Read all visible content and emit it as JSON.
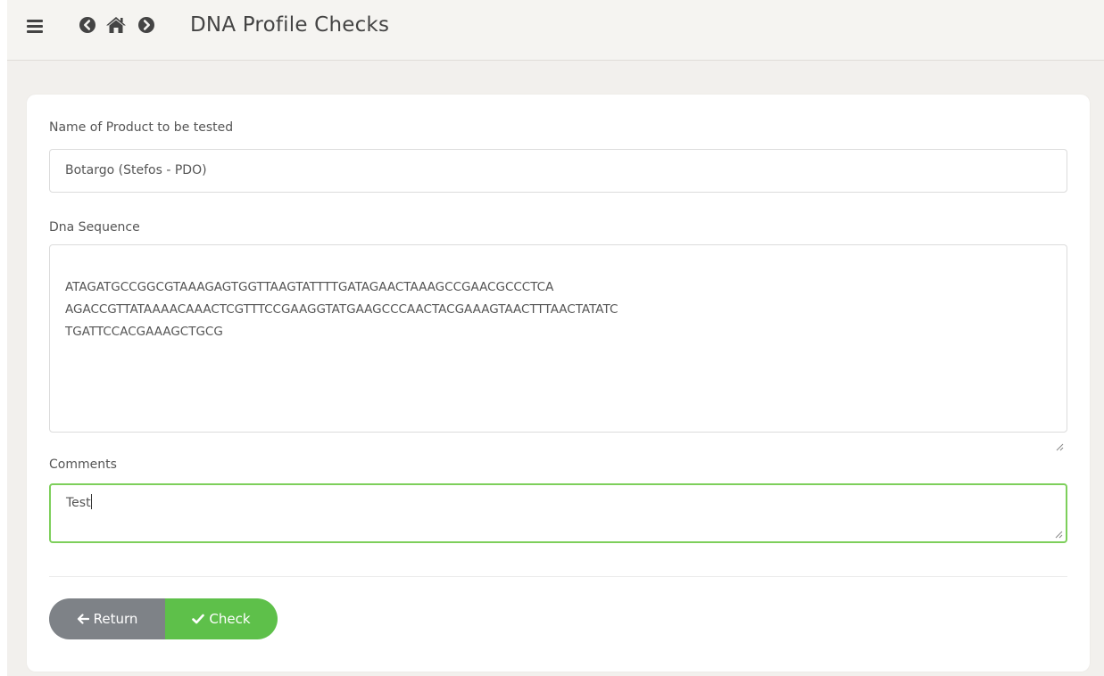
{
  "header": {
    "title": "DNA Profile Checks",
    "icons": [
      "menu-icon",
      "back-circle-icon",
      "home-icon",
      "forward-circle-icon"
    ]
  },
  "form": {
    "product": {
      "label": "Name of Product to be tested",
      "value": "Botargo (Stefos - PDO)"
    },
    "dna": {
      "label": "Dna Sequence",
      "value": "ATAGATGCCGGCGTAAAGAGTGGTTAAGTATTTTGATAGAACTAAAGCCGAACGCCCTCA\nAGACCGTTATAAAACAAACTCGTTTCCGAAGGTATGAAGCCCAACTACGAAAGTAACTTTAACTATATC\nTGATTCCACGAAAGCTGCG"
    },
    "comments": {
      "label": "Comments",
      "value": "Test"
    }
  },
  "actions": {
    "return_label": "Return",
    "check_label": "Check"
  },
  "colors": {
    "accent_green": "#5ec04a",
    "return_gray": "#7e8287",
    "focus_border": "#7dcf5b"
  }
}
